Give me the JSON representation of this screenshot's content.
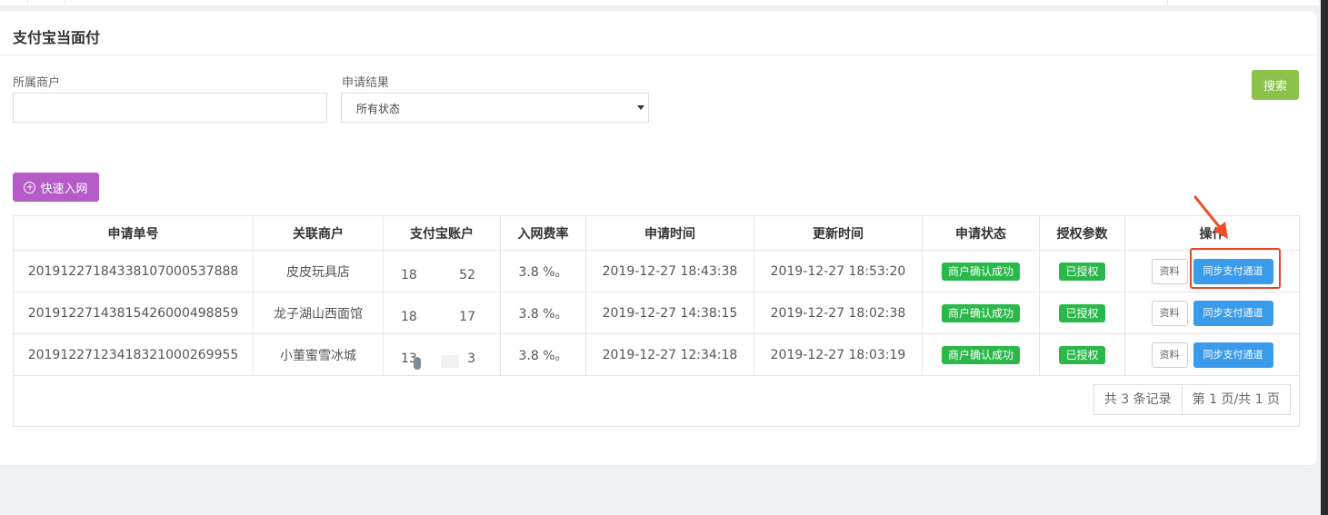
{
  "page": {
    "title": "支付宝当面付"
  },
  "filters": {
    "merchant_label": "所属商户",
    "merchant_value": "",
    "result_label": "申请结果",
    "result_selected": "所有状态",
    "search_button": "搜索"
  },
  "actions": {
    "quick_join": "快速入网"
  },
  "table": {
    "headers": [
      "申请单号",
      "关联商户",
      "支付宝账户",
      "入网费率",
      "申请时间",
      "更新时间",
      "申请状态",
      "授权参数",
      "操作"
    ],
    "rows": [
      {
        "order_no": "20191227184338107000537888",
        "merchant": "皮皮玩具店",
        "account_head": "18",
        "account_tail": "52",
        "rate": "3.8 %。",
        "apply_time": "2019-12-27 18:43:38",
        "update_time": "2019-12-27 18:53:20",
        "status": "商户确认成功",
        "auth": "已授权",
        "btn_info": "资料",
        "btn_sync": "同步支付通道"
      },
      {
        "order_no": "20191227143815426000498859",
        "merchant": "龙子湖山西面馆",
        "account_head": "18",
        "account_tail": "17",
        "rate": "3.8 %。",
        "apply_time": "2019-12-27 14:38:15",
        "update_time": "2019-12-27 18:02:38",
        "status": "商户确认成功",
        "auth": "已授权",
        "btn_info": "资料",
        "btn_sync": "同步支付通道"
      },
      {
        "order_no": "20191227123418321000269955",
        "merchant": "小董蜜雪冰城",
        "account_head": "13",
        "account_tail": "3",
        "rate": "3.8 %。",
        "apply_time": "2019-12-27 12:34:18",
        "update_time": "2019-12-27 18:03:19",
        "status": "商户确认成功",
        "auth": "已授权",
        "btn_info": "资料",
        "btn_sync": "同步支付通道"
      }
    ]
  },
  "pagination": {
    "total": "共 3 条记录",
    "page": "第 1 页/共 1 页"
  },
  "colors": {
    "search_button": "#8bc34a",
    "quick_join_button": "#b55cc8",
    "status_tag": "#2ab84a",
    "sync_button": "#3a9bea",
    "highlight": "#e8452d"
  }
}
